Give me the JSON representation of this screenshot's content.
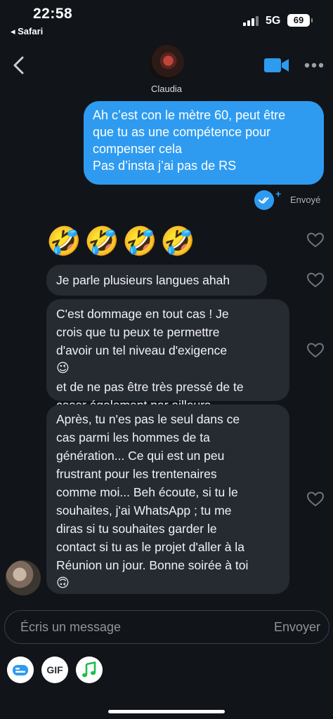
{
  "status_bar": {
    "time": "22:58",
    "back_app": "Safari",
    "network": "5G",
    "battery": "69"
  },
  "header": {
    "contact_name": "Claudia"
  },
  "sent_message": {
    "lines": [
      "Ah c’est con le mètre 60, peut être",
      "que tu as une compétence pour",
      "compenser cela",
      "Pas d’insta j’ai pas de RS"
    ],
    "status": "Envoyé"
  },
  "emoji_message": [
    "🤣",
    "🤣",
    "🤣",
    "🤣"
  ],
  "received_messages": [
    {
      "lines": [
        "Je parle plusieurs langues ahah"
      ]
    },
    {
      "lines": [
        "C'est dommage en tout cas ! Je",
        "crois que tu peux te permettre",
        "d'avoir un tel niveau d'exigence ",
        "et de ne pas être très pressé de te",
        "caser également par ailleurs "
      ],
      "emoji_a": "😉",
      "emoji_b": "😜"
    },
    {
      "lines": [
        "Après,  tu n'es pas le seul dans ce",
        "cas parmi les hommes de ta",
        "génération... Ce qui est un peu",
        "frustrant pour les trentenaires",
        "comme moi... Beh écoute, si tu le",
        "souhaites, j'ai WhatsApp ; tu me",
        "diras si tu souhaites garder le",
        "contact si tu as le projet d'aller à la",
        "Réunion un jour. Bonne soirée à toi",
        ""
      ],
      "emoji_end": "🙃"
    }
  ],
  "composer": {
    "placeholder": "Écris un message",
    "send_label": "Envoyer"
  },
  "tools": {
    "gif_label": "GIF"
  },
  "colors": {
    "accent": "#2e9bf0",
    "background": "#111419",
    "received_bubble": "#262a31",
    "music_green": "#1fbd4c"
  }
}
